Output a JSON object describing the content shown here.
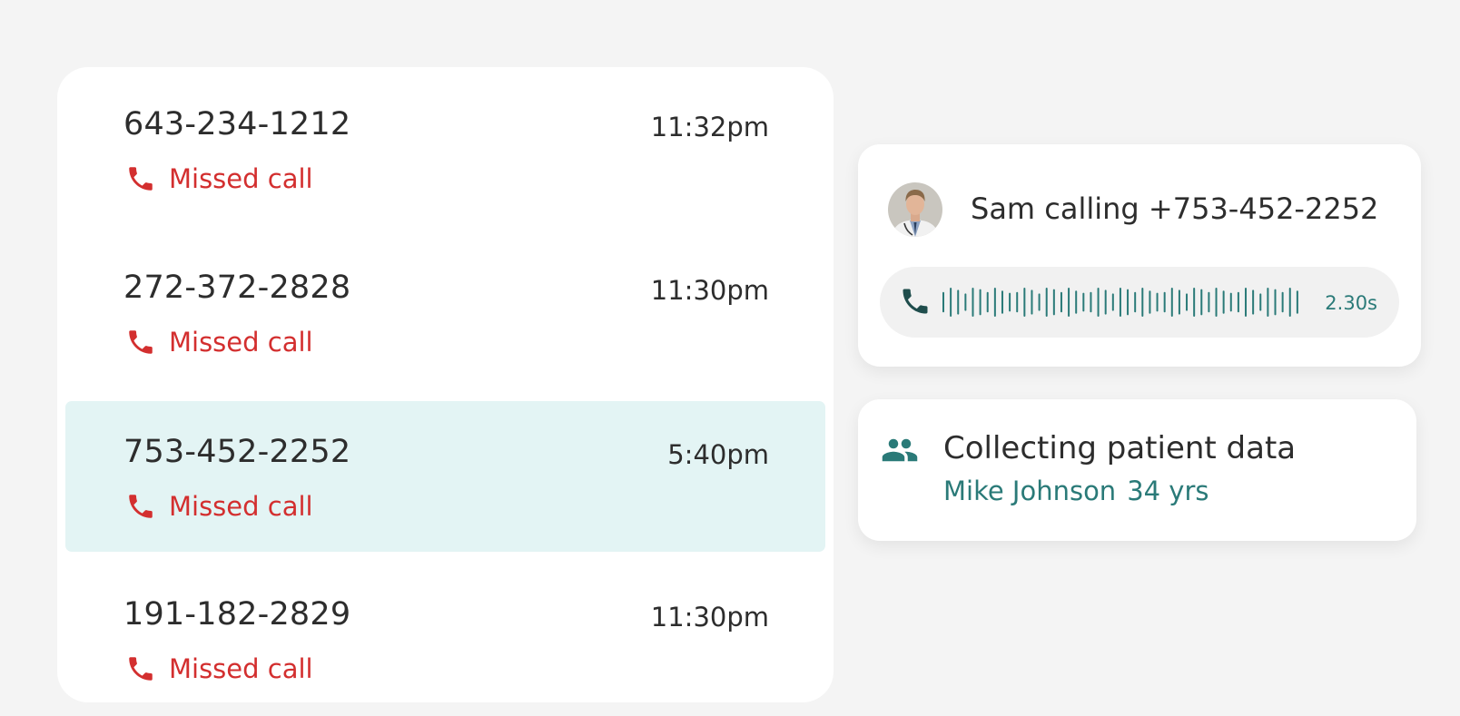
{
  "call_log": {
    "items": [
      {
        "number": "643-234-1212",
        "time": "11:32pm",
        "status": "Missed call",
        "selected": false
      },
      {
        "number": "272-372-2828",
        "time": "11:30pm",
        "status": "Missed call",
        "selected": false
      },
      {
        "number": "753-452-2252",
        "time": "5:40pm",
        "status": "Missed call",
        "selected": true
      },
      {
        "number": "191-182-2829",
        "time": "11:30pm",
        "status": "Missed call",
        "selected": false
      }
    ]
  },
  "incoming_call": {
    "caller_text": "Sam calling +753-452-2252",
    "duration": "2.30s",
    "icon": "phone-icon"
  },
  "patient_status": {
    "title": "Collecting patient data",
    "patient_name": "Mike Johnson",
    "patient_age": "34 yrs",
    "icon": "people-icon"
  },
  "colors": {
    "missed": "#d32f2f",
    "accent": "#2a7a78",
    "selected_row": "#e3f4f4"
  }
}
